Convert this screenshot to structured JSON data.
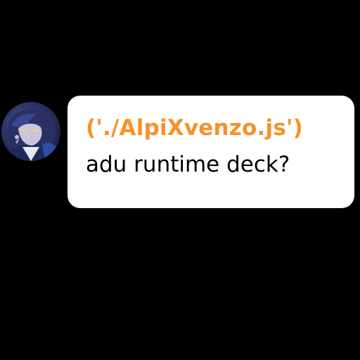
{
  "avatar": {
    "icon": "anime-character-avatar"
  },
  "message": {
    "code_line": "('./AlpiXvenzo.js')",
    "code_color": "#f5922a",
    "text_line": "adu runtime deck?"
  }
}
